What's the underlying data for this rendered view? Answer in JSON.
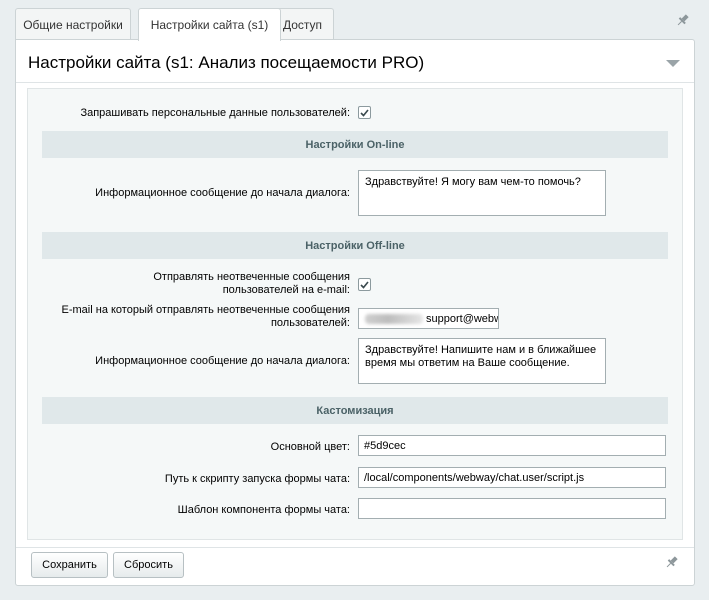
{
  "tabs": [
    {
      "label": "Общие настройки"
    },
    {
      "label": "Настройки сайта (s1)",
      "active": true
    },
    {
      "label": "Доступ"
    }
  ],
  "panel": {
    "title": "Настройки сайта (s1: Анализ посещаемости PRO)"
  },
  "form": {
    "ask_personal": {
      "label": "Запрашивать персональные данные пользователей:",
      "checked": true
    },
    "online": {
      "header": "Настройки On-line",
      "message_label": "Информационное сообщение до начала диалога:",
      "message_value": "Здравствуйте! Я могу вам чем-то помочь?"
    },
    "offline": {
      "header": "Настройки Off-line",
      "send_unanswered_label_1": "Отправлять неотвеченные сообщения",
      "send_unanswered_label_2": "пользователей на e-mail:",
      "send_unanswered_checked": true,
      "email_label_1": "E-mail на который отправлять неотвеченные сообщения",
      "email_label_2": "пользователей:",
      "email_value_visible": "support@webw",
      "message_label": "Информационное сообщение до начала диалога:",
      "message_value": "Здравствуйте! Напишите нам и в ближайшее время мы ответим на Ваше сообщение."
    },
    "custom": {
      "header": "Кастомизация",
      "main_color_label": "Основной цвет:",
      "main_color_value": "#5d9cec",
      "script_path_label": "Путь к скрипту запуска формы чата:",
      "script_path_value": "/local/components/webway/chat.user/script.js",
      "template_label": "Шаблон компонента формы чата:",
      "template_value": ""
    }
  },
  "buttons": {
    "save": "Сохранить",
    "reset": "Сбросить"
  },
  "icons": {
    "pin": "pin-icon",
    "collapse": "chevron-down-icon",
    "check": "checkmark-icon"
  }
}
